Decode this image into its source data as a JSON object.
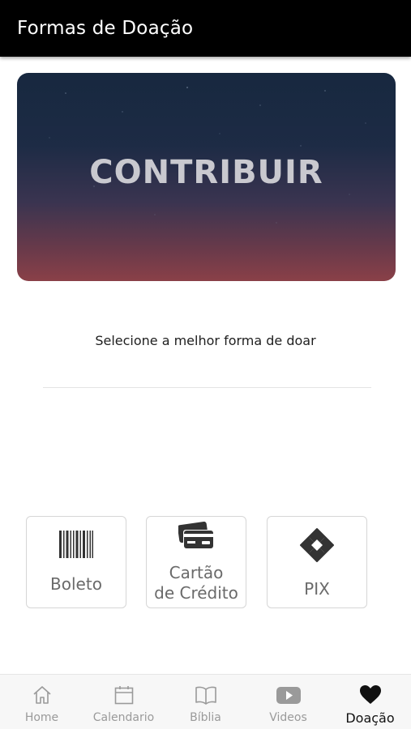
{
  "header": {
    "title": "Formas de Doação"
  },
  "banner": {
    "text": "CONTRIBUIR"
  },
  "subtitle": "Selecione a melhor forma de doar",
  "options": [
    {
      "label": "Boleto",
      "icon": "barcode-icon"
    },
    {
      "label_line1": "Cartão",
      "label_line2": "de Crédito",
      "icon": "credit-card-icon"
    },
    {
      "label": "PIX",
      "icon": "pix-icon"
    }
  ],
  "bottom_nav": {
    "items": [
      {
        "label": "Home",
        "icon": "home-icon"
      },
      {
        "label": "Calendario",
        "icon": "calendar-icon"
      },
      {
        "label": "Bíblia",
        "icon": "book-icon"
      },
      {
        "label": "Videos",
        "icon": "play-icon"
      },
      {
        "label": "Doação",
        "icon": "heart-icon",
        "active": true
      }
    ]
  },
  "colors": {
    "header_bg": "#000000",
    "banner_top": "#17283f",
    "banner_bottom": "#8a4048",
    "nav_active": "#111111",
    "nav_inactive": "#9a9a9a"
  }
}
